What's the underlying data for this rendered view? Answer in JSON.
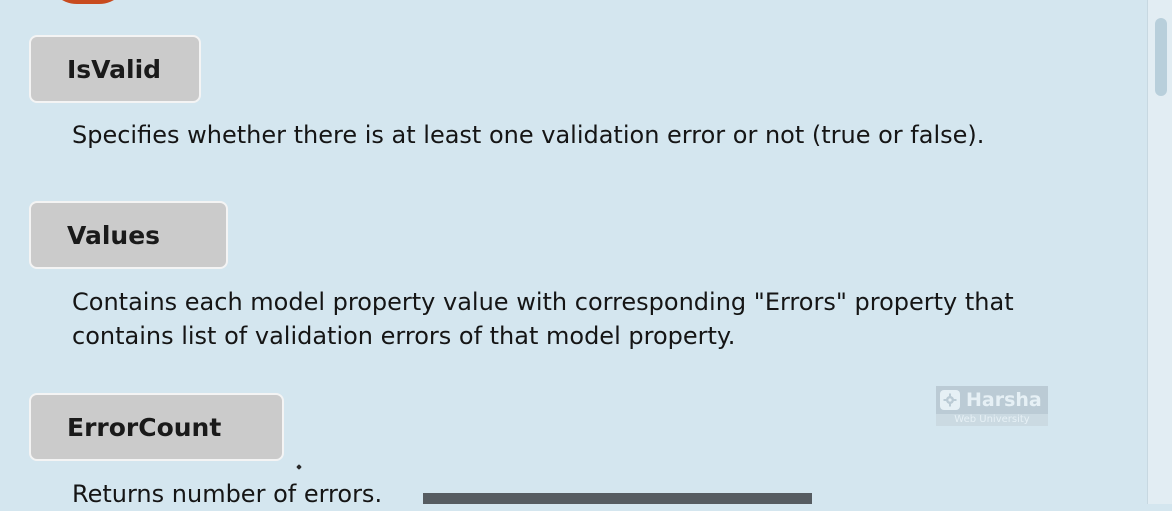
{
  "items": [
    {
      "label": "IsValid",
      "description": "Specifies whether there is at least one validation error or not (true or false)."
    },
    {
      "label": "Values",
      "description": "Contains each model property value with corresponding \"Errors\" property that contains list of validation errors of that model property."
    },
    {
      "label": "ErrorCount",
      "description": "Returns number of errors."
    }
  ],
  "watermark": {
    "name": "Harsha",
    "subtitle": "Web University",
    "icon": "gear-icon"
  },
  "colors": {
    "background": "#d4e6ef",
    "label_box": "#cbcbcb",
    "accent_circle": "#c84b1f",
    "dark_bar": "#565c61"
  }
}
